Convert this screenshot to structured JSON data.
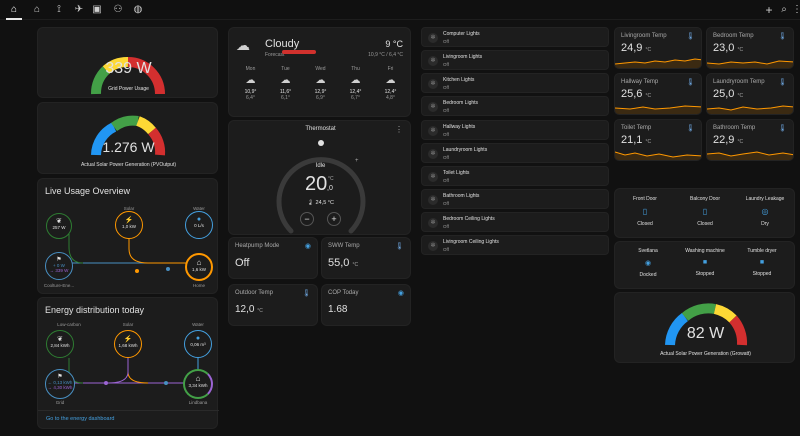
{
  "colors": {
    "accent": "#44a0e0",
    "solar": "#ff9800",
    "grid": "#488fc2",
    "battery": "#9c64d4",
    "home": "#ff9800",
    "green": "#2e7d32"
  },
  "nav": {
    "tabs": [
      "home-icon",
      "house-icon",
      "pv-icon",
      "meter-icon",
      "network-icon",
      "palette-icon"
    ]
  },
  "toolbar": {
    "icons": [
      "plus-icon",
      "search-icon",
      "more-vert-icon"
    ]
  },
  "grid_power": {
    "value": "339 W",
    "label": "Grid Power Usage",
    "level": 0.34
  },
  "solar_pv": {
    "value": "1.276 W",
    "label": "Actual Solar Power Generation (PVOutput)",
    "level": 0.62
  },
  "live_usage": {
    "title": "Live Usage Overview",
    "solar_label": "Solar",
    "solar_val": "1,0 kW",
    "water_label": "Water",
    "water_val": "0 L/s",
    "green_val": "257 W",
    "grid_in": "+ 0 W",
    "grid_out": "→ 339 W",
    "grid_label": "Coolture-Ene...",
    "home_val": "1,6 kW",
    "home_label": "Home"
  },
  "energy_dist": {
    "title": "Energy distribution today",
    "lowcarbon_label": "Low-carbon",
    "lowcarbon_val": "2,84 kWh",
    "solar_label": "Solar",
    "solar_val": "1,68 kWh",
    "water_label": "Water",
    "water_val": "0,06 m³",
    "grid_in": "← 0,13 kWh",
    "grid_out": "→ 4,30 kWh",
    "grid_label": "Grid",
    "home_val": "3,34 kWh",
    "home_label": "Lindbana",
    "link": "Go to the energy dashboard"
  },
  "weather": {
    "condition": "Cloudy",
    "subtitle": "Forecast",
    "temp": "9 °C",
    "range": "10,9 °C / 6,4 °C",
    "days": [
      {
        "d": "Mon",
        "hi": "10,9°",
        "lo": "6,4°"
      },
      {
        "d": "Tue",
        "hi": "11,6°",
        "lo": "6,1°"
      },
      {
        "d": "Wed",
        "hi": "12,9°",
        "lo": "6,9°"
      },
      {
        "d": "Thu",
        "hi": "12,4°",
        "lo": "6,7°"
      },
      {
        "d": "Fri",
        "hi": "12,4°",
        "lo": "4,8°"
      }
    ]
  },
  "thermostat": {
    "title": "Thermostat",
    "mode": "Idle",
    "target": "20",
    "decimal": ",0",
    "unit": "°C",
    "current": "24,5 °C",
    "minus": "−",
    "plus": "+",
    "level": 0.45
  },
  "tiles": [
    {
      "name": "Heatpump Mode",
      "value": "Off",
      "icon": "eye-icon"
    },
    {
      "name": "SWW Temp",
      "value": "55,0",
      "unit": "°C",
      "icon": "thermometer-icon"
    },
    {
      "name": "Outdoor Temp",
      "value": "12,0",
      "unit": "°C",
      "icon": "thermometer-icon"
    },
    {
      "name": "COP Today",
      "value": "1.68",
      "icon": "eye-icon"
    }
  ],
  "lights": [
    {
      "name": "Computer Lights",
      "state": "Off"
    },
    {
      "name": "Livingroom Lights",
      "state": "Off"
    },
    {
      "name": "Kitchen Lights",
      "state": "Off"
    },
    {
      "name": "Bedroom Lights",
      "state": "Off"
    },
    {
      "name": "Hallway Lights",
      "state": "Off"
    },
    {
      "name": "Laundryroom Lights",
      "state": "Off"
    },
    {
      "name": "Toilet Lights",
      "state": "Off"
    },
    {
      "name": "Bathroom Lights",
      "state": "Off"
    },
    {
      "name": "Bedroom Ceiling Lights",
      "state": "Off"
    },
    {
      "name": "Livingroom Ceiling Lights",
      "state": "Off"
    }
  ],
  "temps": [
    {
      "name": "Livingroom Temp",
      "value": "24,9",
      "unit": "°C"
    },
    {
      "name": "Bedroom Temp",
      "value": "23,0",
      "unit": "°C"
    },
    {
      "name": "Hallway Temp",
      "value": "25,6",
      "unit": "°C"
    },
    {
      "name": "Laundryroom Temp",
      "value": "25,0",
      "unit": "°C"
    },
    {
      "name": "Toilet Temp",
      "value": "21,1",
      "unit": "°C"
    },
    {
      "name": "Bathroom Temp",
      "value": "22,9",
      "unit": "°C"
    }
  ],
  "doors": [
    {
      "name": "Front Door",
      "state": "Closed"
    },
    {
      "name": "Balcony Door",
      "state": "Closed"
    },
    {
      "name": "Laundry Leakage",
      "state": "Dry"
    }
  ],
  "appliances": [
    {
      "name": "Svetlana",
      "state": "Docked"
    },
    {
      "name": "Washing machine",
      "state": "Stopped"
    },
    {
      "name": "Tumble dryer",
      "state": "Stopped"
    }
  ],
  "growatt": {
    "value": "82 W",
    "label": "Actual Solar Power Generation (Growatt)",
    "level": 0.5
  }
}
